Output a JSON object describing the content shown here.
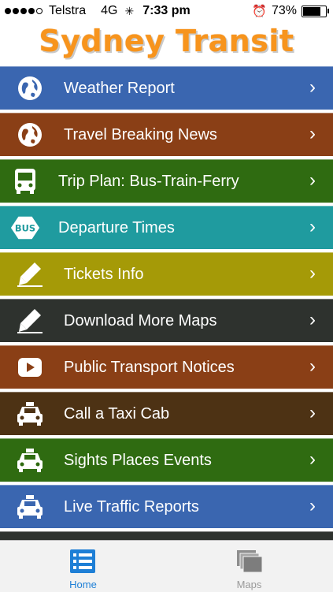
{
  "status_bar": {
    "carrier": "Telstra",
    "network": "4G",
    "time": "7:33 pm",
    "battery": "73%"
  },
  "header": {
    "title": "Sydney Transit",
    "color": "#f7941d"
  },
  "menu": [
    {
      "label": "Weather Report",
      "icon": "globe-icon",
      "color": "#3a66b0"
    },
    {
      "label": "Travel Breaking News",
      "icon": "globe-icon",
      "color": "#8a3f16"
    },
    {
      "label": "Trip Plan: Bus-Train-Ferry",
      "icon": "bus-icon",
      "color": "#2f6b11"
    },
    {
      "label": "Departure Times",
      "icon": "bus-sign-icon",
      "color": "#1f9b9f"
    },
    {
      "label": "Tickets Info",
      "icon": "pen-icon",
      "color": "#a59a07"
    },
    {
      "label": "Download More Maps",
      "icon": "pen-icon",
      "color": "#2e322e"
    },
    {
      "label": "Public Transport Notices",
      "icon": "play-icon",
      "color": "#8a3f16"
    },
    {
      "label": "Call a Taxi Cab",
      "icon": "taxi-icon",
      "color": "#4d3214"
    },
    {
      "label": "Sights Places Events",
      "icon": "taxi-icon",
      "color": "#2f6b11"
    },
    {
      "label": "Live Traffic Reports",
      "icon": "taxi-icon",
      "color": "#3a66b0"
    }
  ],
  "tabs": [
    {
      "label": "Home",
      "icon": "list-icon",
      "active": true
    },
    {
      "label": "Maps",
      "icon": "maps-icon",
      "active": false
    }
  ]
}
